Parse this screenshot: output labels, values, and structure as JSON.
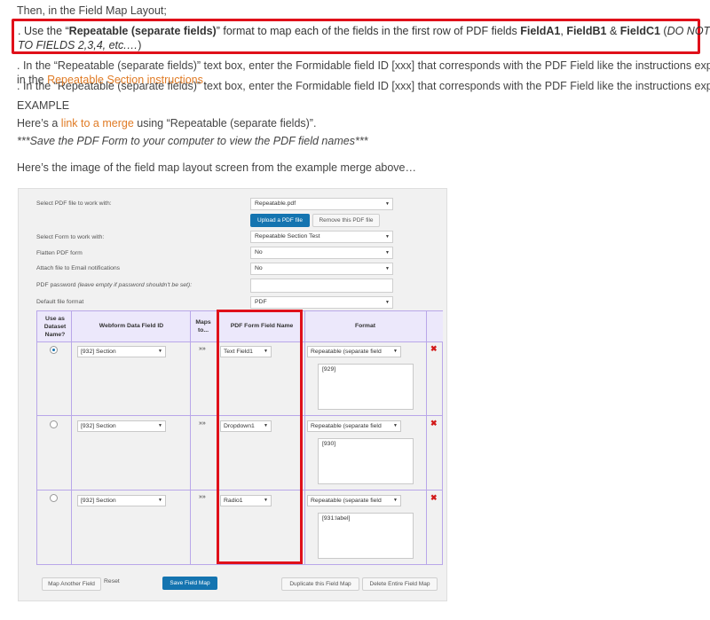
{
  "intro": {
    "line1": "Then, in the Field Map Layout;",
    "step1_a": ". Use the “",
    "step1_bold": "Repeatable (separate fields)",
    "step1_b": "” format to map each of the fields in the first row of PDF fields ",
    "fa1": "FieldA1",
    "comma": ", ",
    "fb1": "FieldB1",
    "amp": " & ",
    "fc1": "FieldC1",
    "paren_open": " (",
    "note_ital_1": "DO NOT MAP",
    "note_ital_2": "TO FIELDS 2,3,4, etc.…",
    "paren_close": ")",
    "step2": ". In the “Repeatable (separate fields)” text box, enter the Formidable field ID [xxx] that corresponds with the PDF Field like the instructions explain",
    "step2_b": "in the ",
    "step2_link": "Repeatable Section instructions",
    "step2_end": ".",
    "example_heading": "EXAMPLE",
    "here_a": "Here’s a ",
    "here_link": "link to a merge",
    "here_b": " using “Repeatable (separate fields)”.",
    "save_note": "***Save the PDF Form to your computer to view the PDF field names***",
    "image_caption": "Here’s the image of the field map layout screen from the example merge above…"
  },
  "form": {
    "pdf_file_label": "Select PDF file to work with:",
    "pdf_file_value": "Repeatable.pdf",
    "upload_btn": "Upload a PDF file",
    "remove_btn": "Remove this PDF file",
    "form_label": "Select Form to work with:",
    "form_value": "Repeatable Section Test",
    "flatten_label": "Flatten PDF form",
    "flatten_value": "No",
    "attach_label": "Attach file to Email notifications",
    "attach_value": "No",
    "password_label": "PDF password ",
    "password_hint": "(leave empty if password shouldn't be set):",
    "password_value": "",
    "format_label": "Default file format",
    "format_value": "PDF"
  },
  "table": {
    "headers": {
      "dataset": [
        "Use as",
        "Dataset",
        "Name?"
      ],
      "webform": "Webform Data Field ID",
      "maps": [
        "Maps",
        "to..."
      ],
      "pdf": "PDF Form Field Name",
      "format": "Format"
    },
    "rows": [
      {
        "selected": true,
        "webform": "[932] Section",
        "maps": "»»",
        "pdf": "Text Field1",
        "format": "Repeatable (separate field",
        "text": "[929]"
      },
      {
        "selected": false,
        "webform": "[932] Section",
        "maps": "»»",
        "pdf": "Dropdown1",
        "format": "Repeatable (separate field",
        "text": "[930]"
      },
      {
        "selected": false,
        "webform": "[932] Section",
        "maps": "»»",
        "pdf": "Radio1",
        "format": "Repeatable (separate field",
        "text": "[931:label]"
      }
    ]
  },
  "footer": {
    "map_another": "Map Another Field",
    "reset": "Reset",
    "save": "Save Field Map",
    "duplicate": "Duplicate this Field Map",
    "delete": "Delete Entire Field Map"
  },
  "icons": {
    "dropdown": "▼",
    "delete": "✖"
  }
}
